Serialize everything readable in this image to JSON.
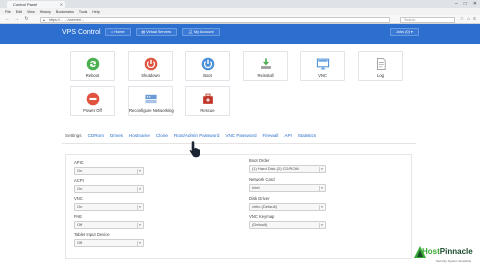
{
  "browser": {
    "tab_title": "Control Panel",
    "menu": [
      "File",
      "Edit",
      "View",
      "History",
      "Bookmarks",
      "Tools",
      "Help"
    ],
    "url": "https://… .../vserver/...",
    "search_placeholder": "Search"
  },
  "header": {
    "brand": "VPS Control",
    "buttons": [
      "Home",
      "Virtual Servers",
      "My Account"
    ],
    "jobs_label": "Jobs (0) ▾"
  },
  "actions": [
    {
      "label": "Reboot",
      "icon": "reboot-icon",
      "color": "#4caf50"
    },
    {
      "label": "Shutdown",
      "icon": "shutdown-icon",
      "color": "#e0533f"
    },
    {
      "label": "Boot",
      "icon": "boot-icon",
      "color": "#4a8fd8"
    },
    {
      "label": "Reinstall",
      "icon": "reinstall-icon",
      "color": "#4caf50"
    },
    {
      "label": "VNC",
      "icon": "vnc-icon",
      "color": "#4a8fd8"
    },
    {
      "label": "Log",
      "icon": "log-icon",
      "color": "#9a9a9a"
    },
    {
      "label": "Power Off",
      "icon": "power-off-icon",
      "color": "#e0533f"
    },
    {
      "label": "Reconfigure Networking",
      "icon": "network-icon",
      "color": "#4a8fd8"
    },
    {
      "label": "Rescue",
      "icon": "rescue-icon",
      "color": "#c0392b"
    }
  ],
  "tabs": [
    "Settings",
    "CDRom",
    "Drives",
    "Hostname",
    "Clone",
    "Root/Admin Password",
    "VNC Password",
    "Firewall",
    "API",
    "Statistics"
  ],
  "settings": {
    "left": [
      {
        "label": "APIC",
        "value": "On"
      },
      {
        "label": "ACPI",
        "value": "On"
      },
      {
        "label": "VNC",
        "value": "On"
      },
      {
        "label": "PAE",
        "value": "Off"
      },
      {
        "label": "Tablet Input Device",
        "value": "Off"
      }
    ],
    "right": [
      {
        "label": "Boot Order",
        "value": "(1) Hard Disk (2) CD/ROM"
      },
      {
        "label": "Network Card",
        "value": "Intel"
      },
      {
        "label": "Disk Driver",
        "value": "virtio (Default)"
      },
      {
        "label": "VNC Keymap",
        "value": "(Default)"
      }
    ]
  },
  "logo": {
    "text_a": "Host",
    "text_b": "Pinnacle",
    "tagline": "Security System Simplicity"
  },
  "colors": {
    "header_bg": "#2d6fcf",
    "link": "#2a6dc9"
  }
}
